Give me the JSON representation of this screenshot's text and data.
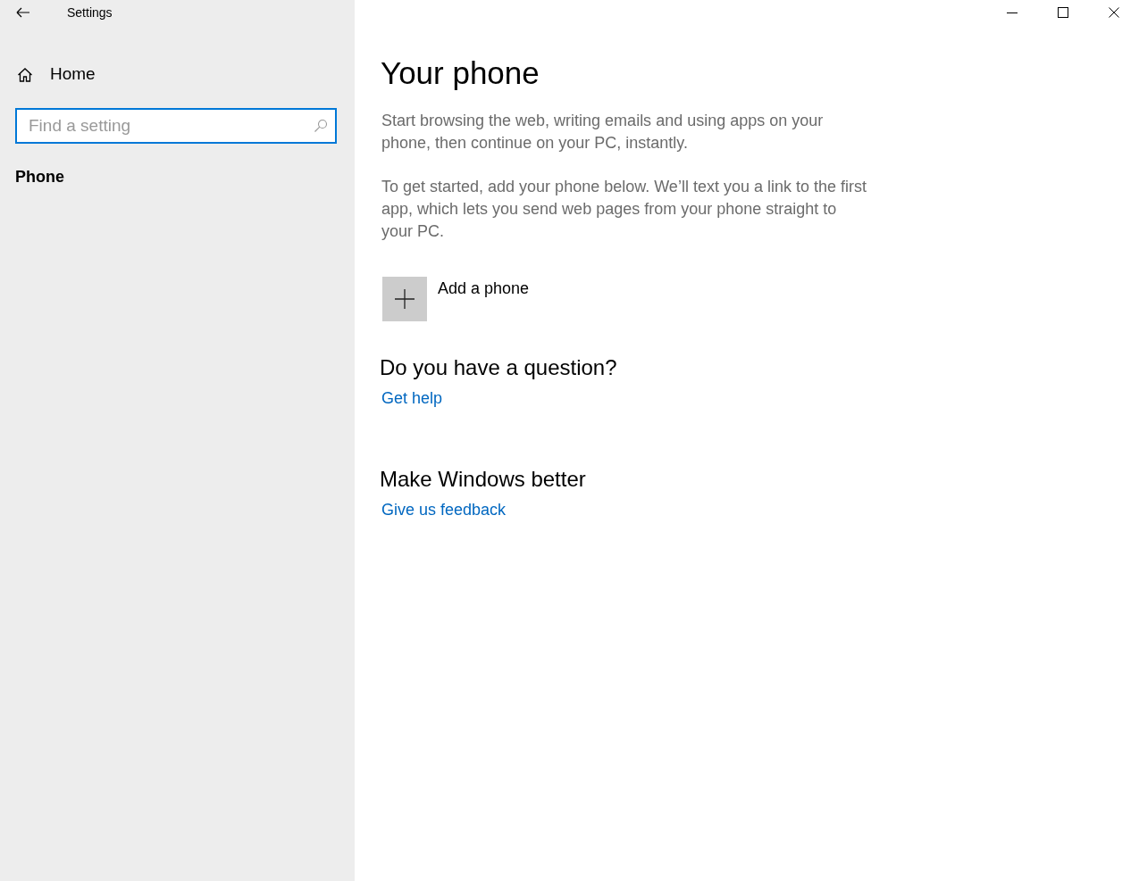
{
  "window": {
    "title": "Settings"
  },
  "sidebar": {
    "home": "Home",
    "search": {
      "placeholder": "Find a setting",
      "focused": true
    },
    "section": "Phone"
  },
  "content": {
    "title": "Your phone",
    "paragraphs": [
      "Start browsing the web, writing emails and using apps on your phone, then continue on your PC, instantly.",
      "To get started, add your phone below. We’ll text you a link to the first app, which lets you send web pages from your phone straight to your PC."
    ],
    "add_button": "Add a phone",
    "sections": [
      {
        "heading": "Do you have a question?",
        "link": "Get help"
      },
      {
        "heading": "Make Windows better",
        "link": "Give us feedback"
      }
    ]
  }
}
